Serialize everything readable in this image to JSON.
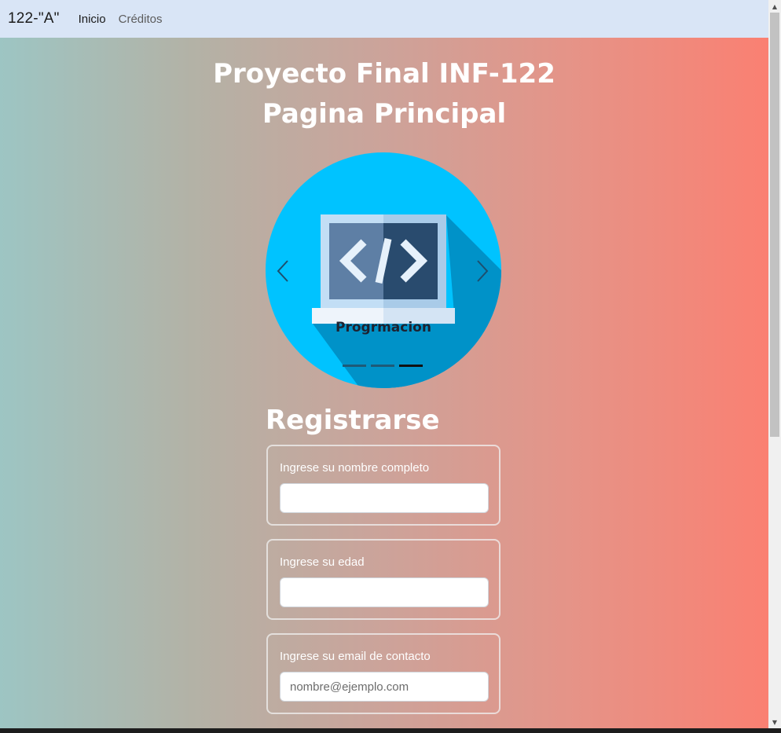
{
  "navbar": {
    "brand": "122-\"A\"",
    "links": [
      {
        "label": "Inicio"
      },
      {
        "label": "Créditos"
      }
    ]
  },
  "header": {
    "title_line1": "Proyecto Final INF-122",
    "title_line2": "Pagina Principal"
  },
  "carousel": {
    "caption": "Progrmacion",
    "image_icon": "code-laptop-icon",
    "prev_icon": "chevron-left-icon",
    "next_icon": "chevron-right-icon",
    "indicator_count": 3,
    "active_indicator": 3
  },
  "form": {
    "title": "Registrarse",
    "fields": [
      {
        "label": "Ingrese su nombre completo",
        "value": "",
        "placeholder": ""
      },
      {
        "label": "Ingrese su edad",
        "value": "",
        "placeholder": ""
      },
      {
        "label": "Ingrese su email de contacto",
        "value": "",
        "placeholder": "nombre@ejemplo.com"
      }
    ]
  },
  "colors": {
    "navbar_bg": "#d9e5f6",
    "gradient_start": "#9dc5c3",
    "gradient_end": "#fa8072",
    "carousel_bg": "#00c3ff"
  }
}
